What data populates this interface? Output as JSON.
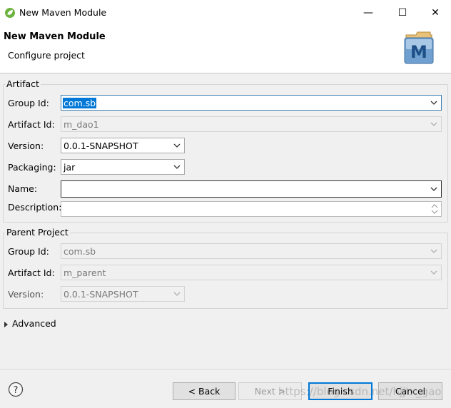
{
  "window": {
    "title": "New Maven Module",
    "min_glyph": "—",
    "max_glyph": "☐",
    "close_glyph": "✕"
  },
  "header": {
    "title": "New Maven Module",
    "subtitle": "Configure project",
    "logo_letter": "M"
  },
  "artifact": {
    "group_label": "Artifact",
    "group_id": {
      "label": "Group Id:",
      "value": "com.sb"
    },
    "artifact_id": {
      "label": "Artifact Id:",
      "value": "m_dao1"
    },
    "version": {
      "label": "Version:",
      "value": "0.0.1-SNAPSHOT"
    },
    "packaging": {
      "label": "Packaging:",
      "value": "jar"
    },
    "name": {
      "label": "Name:",
      "value": ""
    },
    "description": {
      "label": "Description:",
      "value": ""
    }
  },
  "parent": {
    "group_label": "Parent Project",
    "group_id": {
      "label": "Group Id:",
      "value": "com.sb"
    },
    "artifact_id": {
      "label": "Artifact Id:",
      "value": "m_parent"
    },
    "version": {
      "label": "Version:",
      "value": "0.0.1-SNAPSHOT"
    }
  },
  "advanced": {
    "label": "Advanced"
  },
  "footer": {
    "back_label": "< Back",
    "next_label": "Next >",
    "finish_label": "Finish",
    "cancel_label": "Cancel",
    "help_glyph": "?"
  },
  "watermark": "https://blog.csdn.net/hjjtx_gao",
  "colors": {
    "selection": "#0078d7",
    "spring_green": "#6db33f"
  }
}
